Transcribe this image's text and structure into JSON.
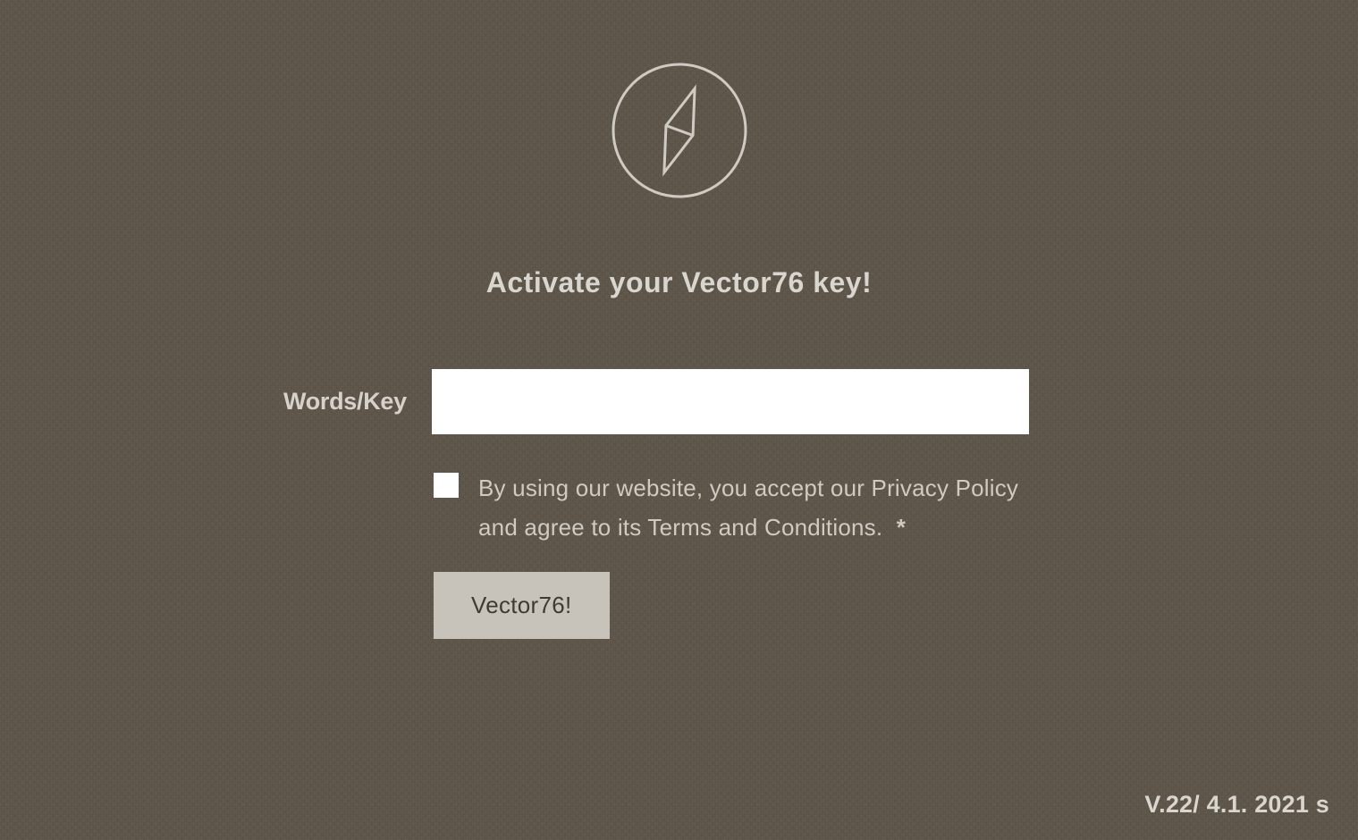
{
  "heading": "Activate your Vector76 key!",
  "form": {
    "field_label": "Words/Key",
    "input_value": "",
    "input_placeholder": "",
    "consent_text": "By using our website, you accept our Privacy Policy and agree to its Terms and Conditions.",
    "asterisk": "*",
    "submit_label": "Vector76!"
  },
  "footer": {
    "version": "V.22/ 4.1. 2021 s"
  }
}
